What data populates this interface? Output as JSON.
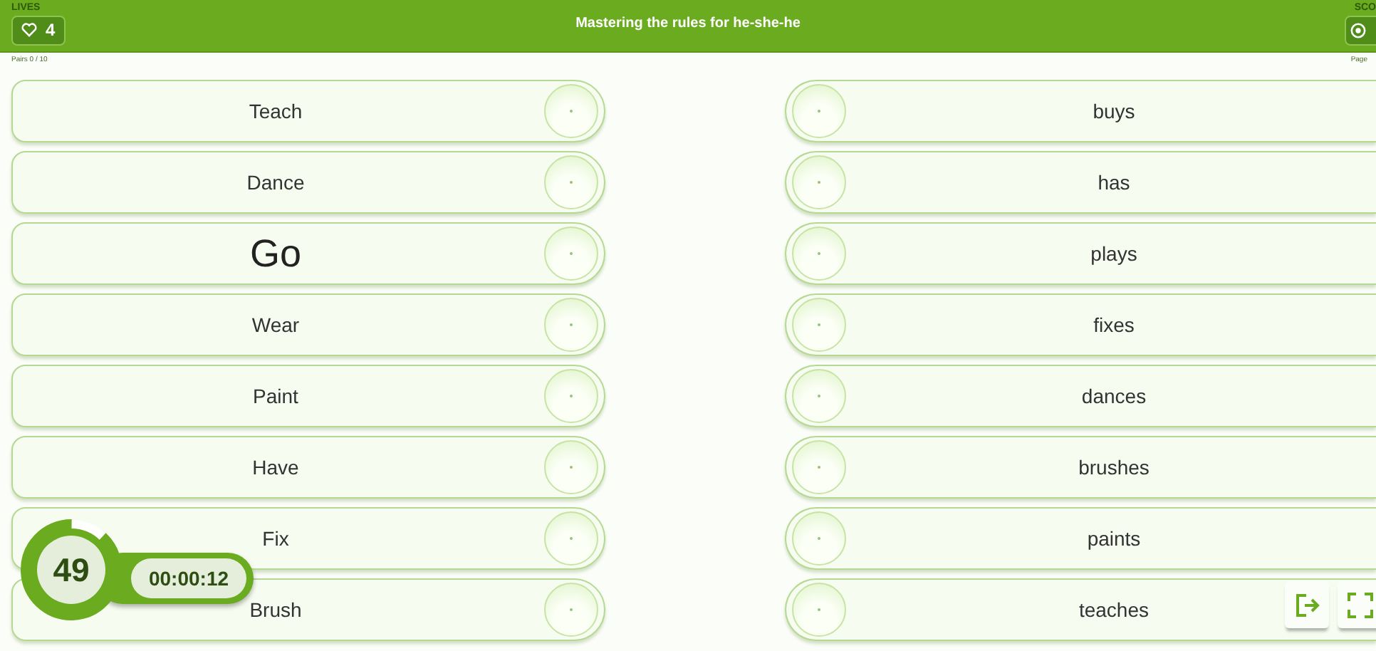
{
  "header": {
    "lives_label": "LIVES",
    "lives": "4",
    "title": "Mastering the rules for he-she-he",
    "score_label": "SCO",
    "pairs": "Pairs 0 / 10",
    "page": "Page"
  },
  "left_cards": [
    {
      "text": "Teach",
      "highlighted": false
    },
    {
      "text": "Dance",
      "highlighted": false
    },
    {
      "text": "Go",
      "highlighted": true
    },
    {
      "text": "Wear",
      "highlighted": false
    },
    {
      "text": "Paint",
      "highlighted": false
    },
    {
      "text": "Have",
      "highlighted": false
    },
    {
      "text": "Fix",
      "highlighted": false
    },
    {
      "text": "Brush",
      "highlighted": false
    }
  ],
  "right_cards": [
    {
      "text": "buys",
      "highlighted": false
    },
    {
      "text": "has",
      "highlighted": false
    },
    {
      "text": "plays",
      "highlighted": false
    },
    {
      "text": "fixes",
      "highlighted": false
    },
    {
      "text": "dances",
      "highlighted": false
    },
    {
      "text": "brushes",
      "highlighted": false
    },
    {
      "text": "paints",
      "highlighted": false
    },
    {
      "text": "teaches",
      "highlighted": false
    }
  ],
  "timer": {
    "count": "49",
    "time": "00:00:12",
    "level": 0.88
  }
}
